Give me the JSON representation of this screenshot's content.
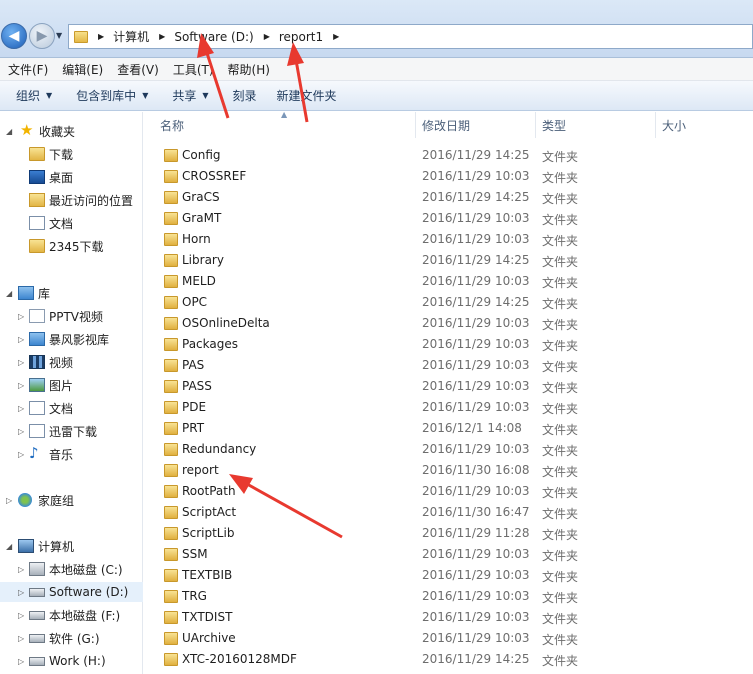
{
  "address": {
    "back_glyph": "◀",
    "forward_glyph": "▶",
    "crumbs": [
      "计算机",
      "Software (D:)",
      "report1"
    ]
  },
  "menu": [
    "文件(F)",
    "编辑(E)",
    "查看(V)",
    "工具(T)",
    "帮助(H)"
  ],
  "commands": {
    "organize": "组织",
    "include": "包含到库中",
    "share": "共享",
    "burn": "刻录",
    "newfolder": "新建文件夹"
  },
  "nav": {
    "favorites": "收藏夹",
    "downloads": "下载",
    "desktop": "桌面",
    "recent": "最近访问的位置",
    "documents_fav": "文档",
    "dl2345": "2345下载",
    "libraries": "库",
    "pptv": "PPTV视频",
    "baofeng": "暴风影视库",
    "video": "视频",
    "pictures": "图片",
    "documents": "文档",
    "xunlei": "迅雷下载",
    "music": "音乐",
    "homegroup": "家庭组",
    "computer": "计算机",
    "drive_c": "本地磁盘 (C:)",
    "drive_d": "Software (D:)",
    "drive_f": "本地磁盘 (F:)",
    "drive_g": "软件 (G:)",
    "drive_h": "Work (H:)"
  },
  "columns": {
    "name": "名称",
    "date": "修改日期",
    "type": "类型",
    "size": "大小"
  },
  "files": [
    {
      "name": "Config",
      "date": "2016/11/29 14:25",
      "type": "文件夹"
    },
    {
      "name": "CROSSREF",
      "date": "2016/11/29 10:03",
      "type": "文件夹"
    },
    {
      "name": "GraCS",
      "date": "2016/11/29 14:25",
      "type": "文件夹"
    },
    {
      "name": "GraMT",
      "date": "2016/11/29 10:03",
      "type": "文件夹"
    },
    {
      "name": "Horn",
      "date": "2016/11/29 10:03",
      "type": "文件夹"
    },
    {
      "name": "Library",
      "date": "2016/11/29 14:25",
      "type": "文件夹"
    },
    {
      "name": "MELD",
      "date": "2016/11/29 10:03",
      "type": "文件夹"
    },
    {
      "name": "OPC",
      "date": "2016/11/29 14:25",
      "type": "文件夹"
    },
    {
      "name": "OSOnlineDelta",
      "date": "2016/11/29 10:03",
      "type": "文件夹"
    },
    {
      "name": "Packages",
      "date": "2016/11/29 10:03",
      "type": "文件夹"
    },
    {
      "name": "PAS",
      "date": "2016/11/29 10:03",
      "type": "文件夹"
    },
    {
      "name": "PASS",
      "date": "2016/11/29 10:03",
      "type": "文件夹"
    },
    {
      "name": "PDE",
      "date": "2016/11/29 10:03",
      "type": "文件夹"
    },
    {
      "name": "PRT",
      "date": "2016/12/1 14:08",
      "type": "文件夹"
    },
    {
      "name": "Redundancy",
      "date": "2016/11/29 10:03",
      "type": "文件夹"
    },
    {
      "name": "report",
      "date": "2016/11/30 16:08",
      "type": "文件夹"
    },
    {
      "name": "RootPath",
      "date": "2016/11/29 10:03",
      "type": "文件夹"
    },
    {
      "name": "ScriptAct",
      "date": "2016/11/30 16:47",
      "type": "文件夹"
    },
    {
      "name": "ScriptLib",
      "date": "2016/11/29 11:28",
      "type": "文件夹"
    },
    {
      "name": "SSM",
      "date": "2016/11/29 10:03",
      "type": "文件夹"
    },
    {
      "name": "TEXTBIB",
      "date": "2016/11/29 10:03",
      "type": "文件夹"
    },
    {
      "name": "TRG",
      "date": "2016/11/29 10:03",
      "type": "文件夹"
    },
    {
      "name": "TXTDIST",
      "date": "2016/11/29 10:03",
      "type": "文件夹"
    },
    {
      "name": "UArchive",
      "date": "2016/11/29 10:03",
      "type": "文件夹"
    },
    {
      "name": "XTC-20160128MDF",
      "date": "2016/11/29 14:25",
      "type": "文件夹"
    }
  ],
  "colors": {
    "annotation_arrow": "#e8392f",
    "selected_nav": "#e5f0fb"
  }
}
